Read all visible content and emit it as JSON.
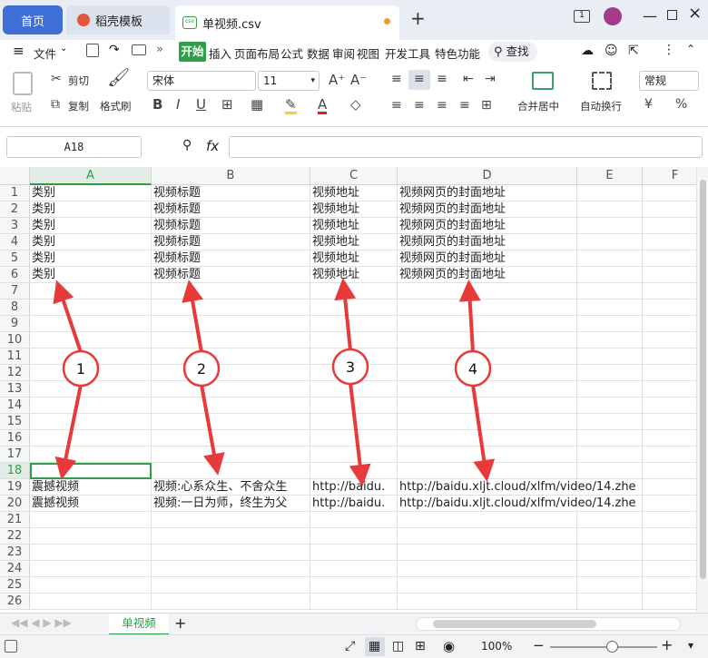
{
  "tabs": {
    "home": "首页",
    "templates": "稻壳模板",
    "file": "单视频.csv",
    "new_tab": "+"
  },
  "window": {
    "tab_count": "1"
  },
  "menubar": {
    "file": "文件",
    "start": "开始",
    "items": [
      "插入",
      "页面布局",
      "公式",
      "数据",
      "审阅",
      "视图",
      "开发工具",
      "特色功能"
    ],
    "search": "查找"
  },
  "toolbar": {
    "paste": "粘贴",
    "cut": "剪切",
    "copy": "复制",
    "format_painter": "格式刷",
    "font_name": "宋体",
    "font_size": "11",
    "merge_center": "合并居中",
    "wrap_text": "自动换行",
    "number_format": "常规",
    "currency": "¥",
    "percent": "%"
  },
  "formula": {
    "name_box": "A18",
    "fx": "fx",
    "value": ""
  },
  "columns": [
    "A",
    "B",
    "C",
    "D",
    "E",
    "F"
  ],
  "rows": [
    {
      "n": "1",
      "A": "类别",
      "B": "视频标题",
      "C": "视频地址",
      "D": "视频网页的封面地址"
    },
    {
      "n": "2",
      "A": "类别",
      "B": "视频标题",
      "C": "视频地址",
      "D": "视频网页的封面地址"
    },
    {
      "n": "3",
      "A": "类别",
      "B": "视频标题",
      "C": "视频地址",
      "D": "视频网页的封面地址"
    },
    {
      "n": "4",
      "A": "类别",
      "B": "视频标题",
      "C": "视频地址",
      "D": "视频网页的封面地址"
    },
    {
      "n": "5",
      "A": "类别",
      "B": "视频标题",
      "C": "视频地址",
      "D": "视频网页的封面地址"
    },
    {
      "n": "6",
      "A": "类别",
      "B": "视频标题",
      "C": "视频地址",
      "D": "视频网页的封面地址"
    },
    {
      "n": "7"
    },
    {
      "n": "8"
    },
    {
      "n": "9"
    },
    {
      "n": "10"
    },
    {
      "n": "11"
    },
    {
      "n": "12"
    },
    {
      "n": "13"
    },
    {
      "n": "14"
    },
    {
      "n": "15"
    },
    {
      "n": "16"
    },
    {
      "n": "17"
    },
    {
      "n": "18"
    },
    {
      "n": "19",
      "A": "震撼视频",
      "B": "视频:心系众生、不舍众生",
      "C": "http://baidu.",
      "D": "http://baidu.xljt.cloud/xlfm/video/14.zhe"
    },
    {
      "n": "20",
      "A": "震撼视频",
      "B": "视频:一日为师，终生为父",
      "C": "http://baidu.",
      "D": "http://baidu.xljt.cloud/xlfm/video/14.zhe"
    },
    {
      "n": "21"
    },
    {
      "n": "22"
    },
    {
      "n": "23"
    },
    {
      "n": "24"
    },
    {
      "n": "25"
    },
    {
      "n": "26"
    }
  ],
  "annotations": [
    "1",
    "2",
    "3",
    "4"
  ],
  "sheet": {
    "name": "单视频",
    "add": "+"
  },
  "status": {
    "zoom": "100%"
  },
  "colors": {
    "accent": "#3d6fd6",
    "start_tab": "#2e9e4a",
    "selection": "#2e9e4a",
    "arrow": "#e83a3a"
  }
}
